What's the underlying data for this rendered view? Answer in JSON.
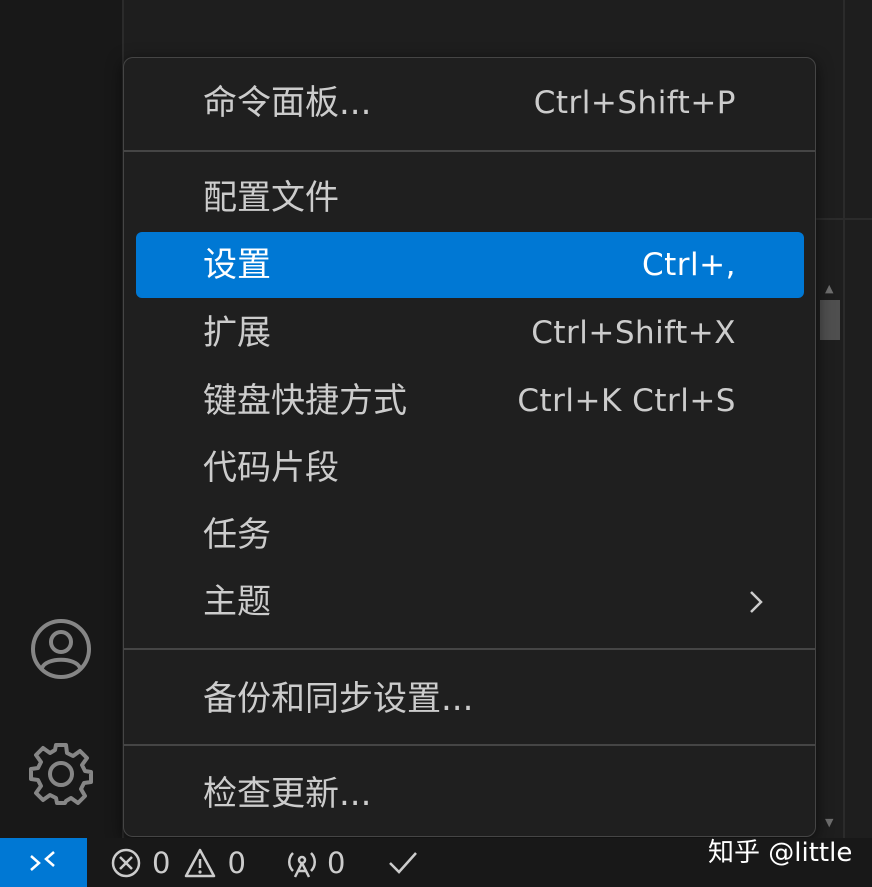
{
  "menu": {
    "items": [
      {
        "label": "命令面板...",
        "shortcut": "Ctrl+Shift+P"
      },
      {
        "label": "配置文件",
        "shortcut": ""
      },
      {
        "label": "设置",
        "shortcut": "Ctrl+,"
      },
      {
        "label": "扩展",
        "shortcut": "Ctrl+Shift+X"
      },
      {
        "label": "键盘快捷方式",
        "shortcut": "Ctrl+K Ctrl+S"
      },
      {
        "label": "代码片段",
        "shortcut": ""
      },
      {
        "label": "任务",
        "shortcut": ""
      },
      {
        "label": "主题",
        "shortcut": ""
      },
      {
        "label": "备份和同步设置...",
        "shortcut": ""
      },
      {
        "label": "检查更新...",
        "shortcut": ""
      }
    ],
    "highlighted_item": "设置"
  },
  "activity_bar": {
    "icons": [
      "accounts-icon",
      "manage-gear-icon"
    ]
  },
  "status_bar": {
    "errors": "0",
    "warnings": "0",
    "ports": "0"
  },
  "watermark": "知乎 @little",
  "colors": {
    "accent": "#0078d4",
    "menu_background": "#1f1f1f",
    "background": "#1e1e1e"
  }
}
